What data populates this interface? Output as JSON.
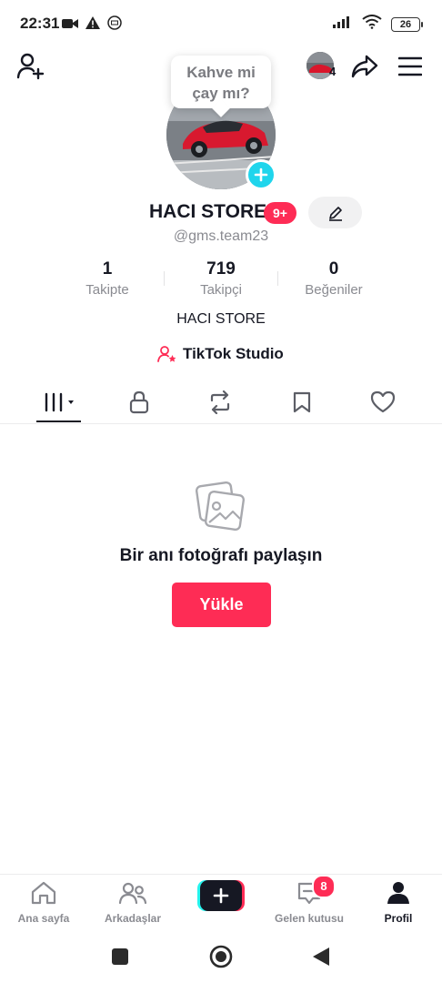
{
  "status_bar": {
    "time": "22:31",
    "battery": "26",
    "icons": [
      "video-icon",
      "warning-icon",
      "app-badge-icon",
      "signal-icon",
      "wifi-icon",
      "battery-icon"
    ]
  },
  "header": {
    "tooltip_line1": "Kahve mi",
    "tooltip_line2": "çay mı?",
    "switch_account_count": "4",
    "icons": [
      "add-user-icon",
      "share-icon",
      "menu-icon"
    ]
  },
  "profile": {
    "name": "HACI STORE",
    "notification_badge": "9+",
    "username": "@gms.team23",
    "bio": "HACI STORE",
    "studio_label": "TikTok Studio"
  },
  "stats": [
    {
      "value": "1",
      "label": "Takipte"
    },
    {
      "value": "719",
      "label": "Takipçi"
    },
    {
      "value": "0",
      "label": "Beğeniler"
    }
  ],
  "tabs": [
    "videos-grid-icon",
    "lock-icon",
    "repost-icon",
    "bookmark-icon",
    "heart-icon"
  ],
  "empty_state": {
    "message": "Bir anı fotoğrafı paylaşın",
    "button_label": "Yükle"
  },
  "bottom_nav": {
    "home": "Ana sayfa",
    "friends": "Arkadaşlar",
    "inbox": "Gelen kutusu",
    "inbox_badge": "8",
    "profile": "Profil"
  },
  "colors": {
    "accent": "#fe2c55",
    "cyan": "#25f4ee",
    "avatar_add": "#20d5ec",
    "text": "#161823",
    "muted": "#8a8b91"
  }
}
